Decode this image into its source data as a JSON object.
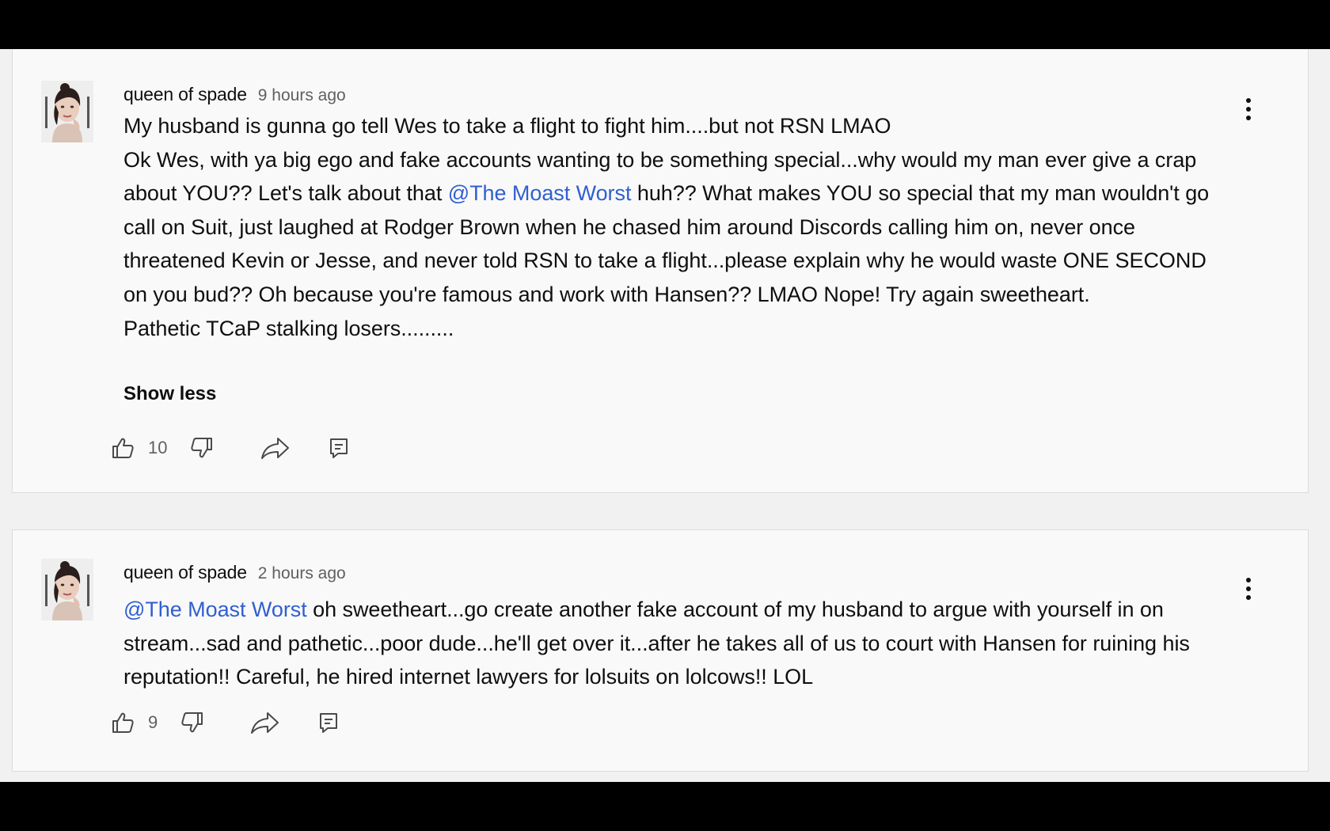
{
  "comments": [
    {
      "author": "queen of spade",
      "timestamp": "9 hours ago",
      "line1": "My husband is gunna go tell Wes to take a flight to fight him....but not RSN LMAO\nOk Wes, with ya big ego and fake accounts wanting to be something special...why would my man ever give a crap about YOU?? Let's talk about that ",
      "mention": "@The Moast Worst",
      "line2": " huh?? What makes YOU so special that my man wouldn't go call on Suit, just laughed at Rodger Brown when he chased him around Discords calling him on, never once threatened Kevin or Jesse, and never told RSN to take a flight...please explain why he would waste ONE SECOND on you bud?? Oh because you're famous and work with Hansen?? LMAO Nope! Try again sweetheart.\nPathetic TCaP stalking losers.........",
      "toggle_label": "Show less",
      "likes": "10",
      "icons": {
        "like": "thumbs-up-icon",
        "dislike": "thumbs-down-icon",
        "share": "share-icon",
        "reply": "reply-icon",
        "menu": "more-vertical-icon"
      }
    },
    {
      "author": "queen of spade",
      "timestamp": "2 hours ago",
      "mention": "@The Moast Worst",
      "text": " oh sweetheart...go create another fake account of my husband to argue with yourself in on stream...sad and pathetic...poor dude...he'll get over it...after he takes all of us to court with Hansen for ruining his reputation!! Careful, he hired internet lawyers for lolsuits on lolcows!! LOL",
      "likes": "9",
      "icons": {
        "like": "thumbs-up-icon",
        "dislike": "thumbs-down-icon",
        "share": "share-icon",
        "reply": "reply-icon",
        "menu": "more-vertical-icon"
      }
    }
  ],
  "colors": {
    "mention": "#2f5fd0",
    "text": "#0f0f0f",
    "meta": "#606060",
    "card": "#f9f9f9",
    "letterbox": "#000000"
  }
}
